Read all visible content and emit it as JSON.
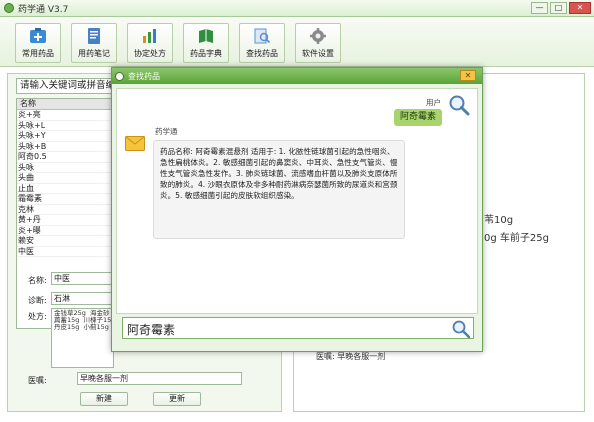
{
  "window": {
    "title": "药学通 V3.7",
    "min_label": "—",
    "max_label": "□",
    "close_label": "✕"
  },
  "toolbar": {
    "buttons": [
      {
        "label": "常用药品",
        "icon": "medicine-box-icon",
        "color": "#3a8ad6"
      },
      {
        "label": "用药笔记",
        "icon": "notebook-icon",
        "color": "#4a7fc4"
      },
      {
        "label": "协定处方",
        "icon": "chart-icon",
        "color": "#e0892a"
      },
      {
        "label": "药品字典",
        "icon": "book-icon",
        "color": "#2f8f3f"
      },
      {
        "label": "查找药品",
        "icon": "search-doc-icon",
        "color": "#5a8fd0"
      },
      {
        "label": "软件设置",
        "icon": "gear-icon",
        "color": "#8a8a8a"
      }
    ]
  },
  "left": {
    "search_placeholder": "请输入关键词或拼音编",
    "list_header": "名称",
    "list_items": [
      "炎+亮",
      "头咏+L",
      "头咏+Y",
      "头咏+B",
      "阿奇0.5",
      "头咏",
      "头曲",
      "止血",
      "霜霉素",
      "克林",
      "黄+丹",
      "炎+曝",
      "赖安",
      "中医"
    ],
    "name_label": "名称:",
    "name_value": "中医",
    "diagnosis_label": "诊断:",
    "diagnosis_value": "石淋",
    "prescription_label": "处方:",
    "prescription_text": "金钱草25g  海金砂\n萹蓄15g  川楝子15\n丹皮15g  小蓟15g",
    "advice_label": "医嘱:",
    "advice_value": "早晚各服一剂",
    "new_button": "新建",
    "update_button": "更新"
  },
  "right": {
    "line1": "苇10g",
    "line2": "0g  车前子25g",
    "line3": "医嘱: 早晚各服一剂"
  },
  "dialog": {
    "title": "查找药品",
    "close_label": "✕",
    "user_label": "用户",
    "user_message": "阿奇霉素",
    "bot_name": "药学通",
    "bot_message": "药品名称: 阿奇霉素混悬剂 适用于: 1. 化脓性链球菌引起的急性咽炎、急性扁桃体炎。2. 敏感细菌引起的鼻窦炎、中耳炎、急性支气管炎、慢性支气管炎急性发作。3. 肺炎链球菌、流感嗜血杆菌以及肺炎支原体所致的肺炎。4. 沙眼衣原体及非多种耐药淋病奈瑟菌所致的尿道炎和宫颈炎。5. 敏感细菌引起的皮肤软组织感染。",
    "input_value": "阿奇霉素"
  },
  "colors": {
    "accent": "#5aa338",
    "bubble": "#a7d46c"
  }
}
